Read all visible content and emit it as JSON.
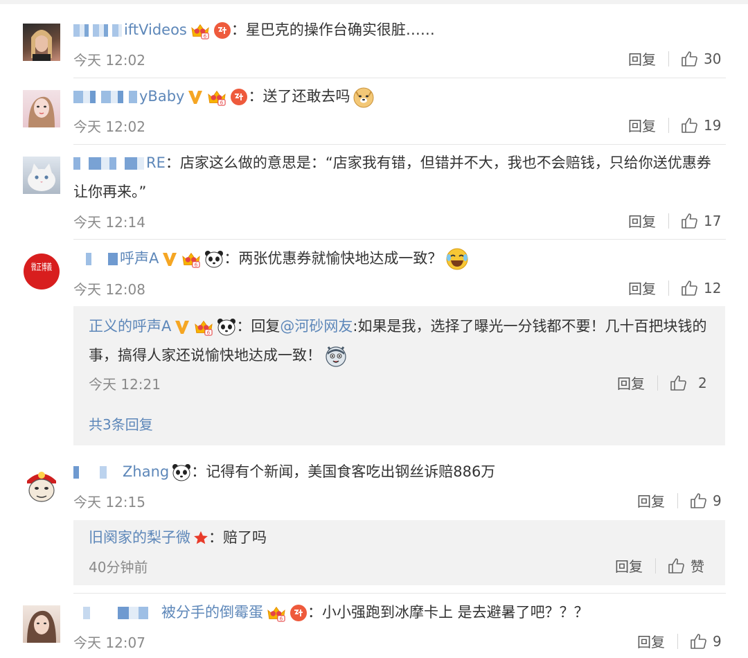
{
  "comments": [
    {
      "user": "iftVideos",
      "text": "：星巴克的操作台确实很脏……",
      "time": "今天 12:02",
      "reply": "回复",
      "likes": "30"
    },
    {
      "user": "yBaby",
      "text": "：送了还敢去吗",
      "time": "今天 12:02",
      "reply": "回复",
      "likes": "19"
    },
    {
      "user": "RE",
      "text": "：店家这么做的意思是：“店家我有错，但错并不大，我也不会赔钱，只给你送优惠券让你再来。”",
      "time": "今天 12:14",
      "reply": "回复",
      "likes": "17"
    },
    {
      "user": "呼声A",
      "text": "：两张优惠券就愉快地达成一致？",
      "time": "今天 12:08",
      "reply": "回复",
      "likes": "12",
      "avatar_text": "微正博義",
      "sub": {
        "user": "正义的呼声A",
        "prefix": "：回复",
        "mention": "@河砂网友",
        "text": ":如果是我，选择了曝光一分钱都不要！几十百把块钱的事，搞得人家还说愉快地达成一致！",
        "time": "今天 12:21",
        "reply": "回复",
        "likes": "2",
        "more": "共3条回复"
      }
    },
    {
      "user": "Zhang",
      "text": "：记得有个新闻，美国食客吃出钢丝诉赔886万",
      "time": "今天 12:15",
      "reply": "回复",
      "likes": "9",
      "sub": {
        "user": "旧阕家的梨子微",
        "text": "：赔了吗",
        "time": "40分钟前",
        "reply": "回复",
        "likes": "赞"
      }
    },
    {
      "user": "被分手的倒霉蛋",
      "text": "：小小强跑到冰摩卡上 是去避暑了吧？？？",
      "time": "今天 12:07",
      "reply": "回复",
      "likes": "9"
    }
  ],
  "colors": {
    "username": "#5d87b9",
    "text": "#333333",
    "time": "#8a8a8a",
    "subbox": "#f2f2f2",
    "vip_v": "#f5a623",
    "crown": "#f5a623",
    "red_badge": "#e8543c"
  },
  "icons": [
    "thumbs-up-icon",
    "vip-v-icon",
    "crown-icon",
    "red-badge-icon",
    "panda-icon",
    "doge-emoji",
    "laughing-emoji",
    "husky-emoji",
    "star-icon"
  ]
}
